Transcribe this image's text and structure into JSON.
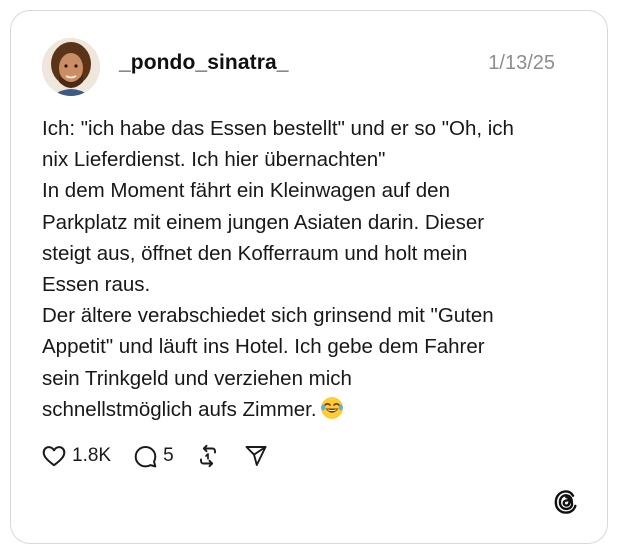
{
  "post": {
    "username": "_pondo_sinatra_",
    "date": "1/13/25",
    "lines": [
      "Ich: \"ich habe das Essen bestellt\" und er so \"Oh, ich",
      "nix Lieferdienst. Ich hier übernachten\"",
      "In dem Moment fährt ein Kleinwagen auf den",
      "Parkplatz mit einem jungen Asiaten darin. Dieser",
      "steigt aus, öffnet den Kofferraum und holt mein",
      "Essen raus.",
      "Der ältere verabschiedet sich grinsend mit \"Guten",
      "Appetit\" und läuft ins Hotel. Ich gebe dem Fahrer",
      "sein Trinkgeld und verziehen mich",
      "schnellstmöglich aufs Zimmer."
    ],
    "emoji": "face-with-tears-of-joy"
  },
  "actions": {
    "likes": "1.8K",
    "comments": "5"
  },
  "icons": {
    "like": "heart-icon",
    "comment": "comment-icon",
    "repost": "repost-icon",
    "share": "send-icon",
    "brand": "threads-logo-icon"
  }
}
